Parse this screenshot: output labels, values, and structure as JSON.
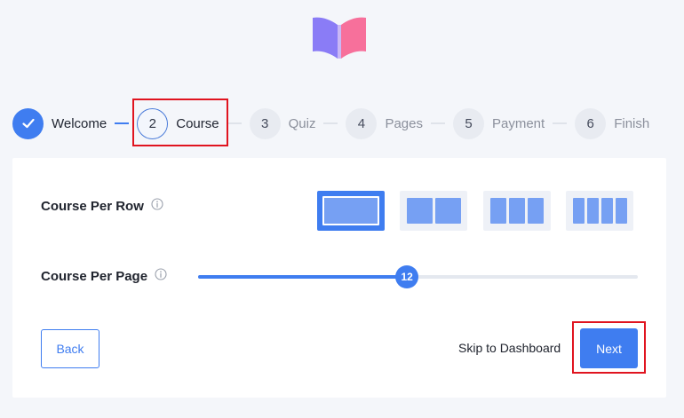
{
  "colors": {
    "accent": "#3f7df0",
    "highlight": "#e0141f",
    "logo_left": "#8a7cf6",
    "logo_right": "#f7709b"
  },
  "stepper": {
    "steps": [
      {
        "number": "",
        "label": "Welcome",
        "state": "completed",
        "icon": "check-icon"
      },
      {
        "number": "2",
        "label": "Course",
        "state": "active"
      },
      {
        "number": "3",
        "label": "Quiz",
        "state": "pending"
      },
      {
        "number": "4",
        "label": "Pages",
        "state": "pending"
      },
      {
        "number": "5",
        "label": "Payment",
        "state": "pending"
      },
      {
        "number": "6",
        "label": "Finish",
        "state": "pending"
      }
    ]
  },
  "settings": {
    "course_per_row": {
      "label": "Course Per Row",
      "options": [
        1,
        2,
        3,
        4
      ],
      "selected": 1
    },
    "course_per_page": {
      "label": "Course Per Page",
      "value": "12",
      "fill_fraction": 0.475
    }
  },
  "actions": {
    "back_label": "Back",
    "skip_label": "Skip to Dashboard",
    "next_label": "Next"
  }
}
